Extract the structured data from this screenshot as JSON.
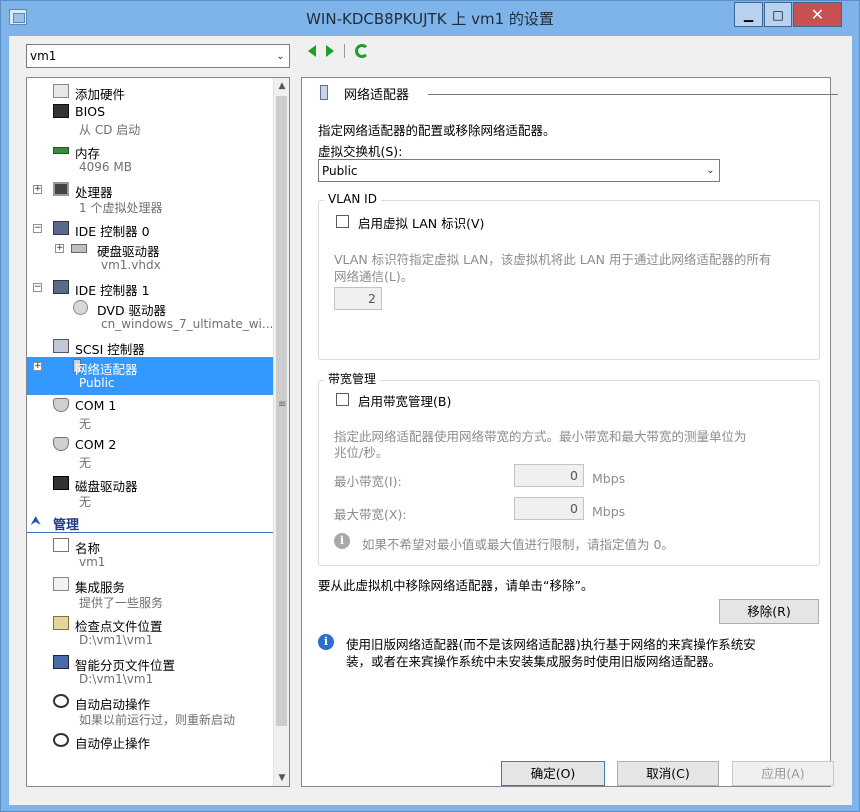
{
  "window": {
    "title": "WIN-KDCB8PKUJTK 上 vm1 的设置",
    "controls": {
      "minimize": "▁",
      "maximize": "□",
      "close": "✕"
    }
  },
  "vm_selector": {
    "value": "vm1",
    "arrow": "⌄"
  },
  "nav": {
    "back_icon": "back-arrow-icon",
    "forward_icon": "forward-arrow-icon",
    "refresh_icon": "refresh-icon"
  },
  "tree": {
    "hardware": [
      {
        "label": "添加硬件",
        "sub": ""
      },
      {
        "label": "BIOS",
        "sub": "从 CD 启动"
      },
      {
        "label": "内存",
        "sub": "4096 MB"
      },
      {
        "label": "处理器",
        "sub": "1 个虚拟处理器",
        "expander": "+"
      },
      {
        "label": "IDE 控制器 0",
        "sub": "",
        "expander": "−"
      },
      {
        "label": "硬盘驱动器",
        "sub": "vm1.vhdx",
        "expander": "+"
      },
      {
        "label": "IDE 控制器 1",
        "sub": "",
        "expander": "−"
      },
      {
        "label": "DVD 驱动器",
        "sub": "cn_windows_7_ultimate_wi..."
      },
      {
        "label": "SCSI 控制器",
        "sub": ""
      },
      {
        "label": "网络适配器",
        "sub": "Public",
        "expander": "+"
      },
      {
        "label": "COM 1",
        "sub": "无"
      },
      {
        "label": "COM 2",
        "sub": "无"
      },
      {
        "label": "磁盘驱动器",
        "sub": "无"
      }
    ],
    "management_header": "管理",
    "management": [
      {
        "label": "名称",
        "sub": "vm1"
      },
      {
        "label": "集成服务",
        "sub": "提供了一些服务"
      },
      {
        "label": "检查点文件位置",
        "sub": "D:\\vm1\\vm1"
      },
      {
        "label": "智能分页文件位置",
        "sub": "D:\\vm1\\vm1"
      },
      {
        "label": "自动启动操作",
        "sub": "如果以前运行过，则重新启动"
      },
      {
        "label": "自动停止操作",
        "sub": ""
      }
    ],
    "selected": "网络适配器"
  },
  "panel": {
    "header": "网络适配器",
    "description": "指定网络适配器的配置或移除网络适配器。",
    "switch_label": "虚拟交换机(S):",
    "switch_value": "Public",
    "vlan": {
      "title": "VLAN ID",
      "checkbox_label": "启用虚拟 LAN 标识(V)",
      "checked": false,
      "help_line1": "VLAN 标识符指定虚拟 LAN，该虚拟机将此 LAN 用于通过此网络适配器的所有",
      "help_line2": "网络通信(L)。",
      "value": "2"
    },
    "bandwidth": {
      "title": "带宽管理",
      "checkbox_label": "启用带宽管理(B)",
      "checked": false,
      "help_line1": "指定此网络适配器使用网络带宽的方式。最小带宽和最大带宽的测量单位为",
      "help_line2": "兆位/秒。",
      "min_label": "最小带宽(I):",
      "min_value": "0",
      "max_label": "最大带宽(X):",
      "max_value": "0",
      "unit": "Mbps",
      "note": "如果不希望对最小值或最大值进行限制，请指定值为 0。"
    },
    "remove_text": "要从此虚拟机中移除网络适配器，请单击“移除”。",
    "remove_button": "移除(R)",
    "legacy_line1": "使用旧版网络适配器(而不是该网络适配器)执行基于网络的来宾操作系统安",
    "legacy_line2": "装，或者在来宾操作系统中未安装集成服务时使用旧版网络适配器。"
  },
  "buttons": {
    "ok": "确定(O)",
    "cancel": "取消(C)",
    "apply": "应用(A)"
  },
  "colors": {
    "selection": "#3399ff",
    "title_bar": "#7eb4ea",
    "info": "#2a6fc9"
  }
}
